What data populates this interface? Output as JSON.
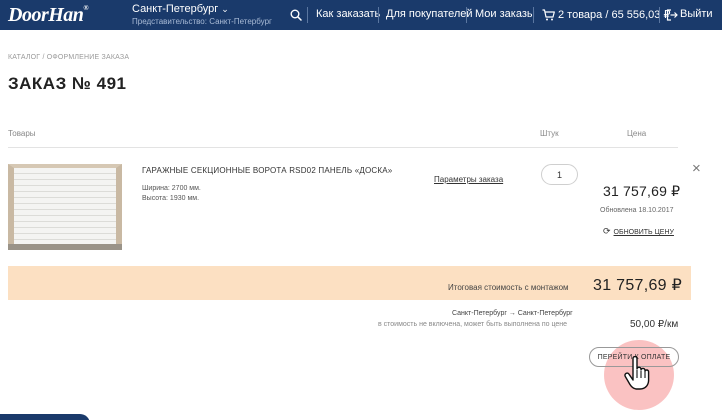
{
  "brand": {
    "logo_text": "DoorHan",
    "logo_mark": "®"
  },
  "location": {
    "city": "Санкт-Петербург",
    "city_arrow": "⌄",
    "representative": "Представительство: Санкт-Петербург"
  },
  "nav": {
    "how_to_order": "Как заказать",
    "for_buyers": "Для покупателей",
    "my_orders": "Мои заказы",
    "cart": "2 товара / 65 556,03 ₽",
    "logout": "Выйти"
  },
  "breadcrumb": "Каталог / Оформление заказа",
  "page_title": "ЗАКАЗ № 491",
  "table": {
    "col_products": "Товары",
    "col_qty": "Штук",
    "col_price": "Цена"
  },
  "item": {
    "name": "ГАРАЖНЫЕ СЕКЦИОННЫЕ ВОРОТА RSD02 ПАНЕЛЬ «ДОСКА»",
    "width": "Ширина: 2700 мм.",
    "height": "Высота: 1930 мм.",
    "params_link": "Параметры заказа",
    "quantity": "1",
    "price": "31 757,69 ₽",
    "updated": "Обновлена 18.10.2017",
    "refresh_label": "обновить цену",
    "remove_icon": "×"
  },
  "total": {
    "label": "Итоговая стоимость с монтажом",
    "value": "31 757,69 ₽"
  },
  "delivery": {
    "route": "Санкт-Петербург → Санкт-Петербург",
    "note": "в стоимость не включена, может быть выполнена по цене",
    "price": "50,00 ₽/км"
  },
  "pay_button": "Перейти к оплате",
  "colors": {
    "header_bg": "#1a3a6b",
    "total_bg": "#fce0c2",
    "click_highlight": "#f68f8f"
  }
}
